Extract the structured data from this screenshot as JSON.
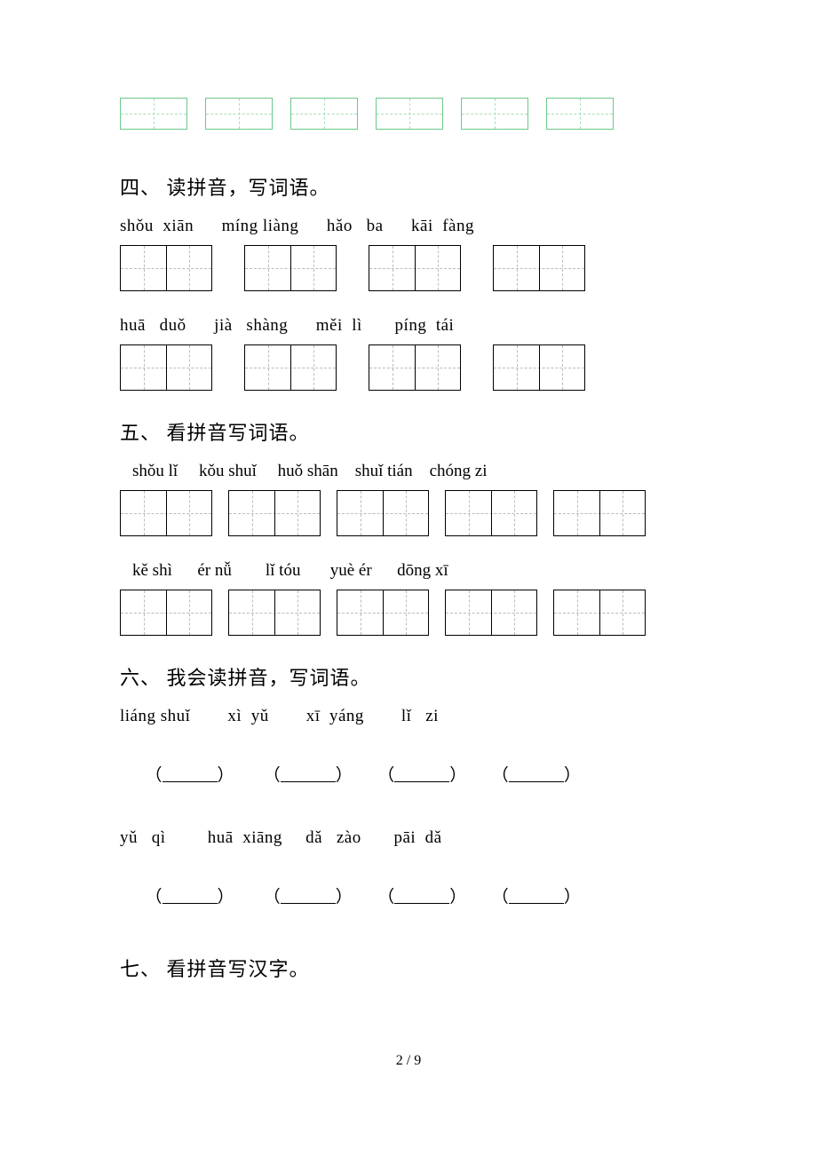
{
  "section4": {
    "heading": "四、 读拼音，写词语。",
    "row1_pinyin": "shǒu  xiān      míng liàng      hǎo   ba      kāi  fàng",
    "row2_pinyin": "huā   duǒ      jià   shàng      měi  lì       píng  tái"
  },
  "section5": {
    "heading": "五、 看拼音写词语。",
    "row1_pinyin": "shǒu lǐ     kǒu shuǐ     huǒ shān    shuǐ tián    chóng zi",
    "row2_pinyin": "kě shì      ér nǚ        lǐ tóu       yuè ér      dōng xī"
  },
  "section6": {
    "heading": "六、 我会读拼音，写词语。",
    "row1_pinyin": "liáng shuǐ        xì  yǔ        xī  yáng        lǐ   zi",
    "row2_pinyin": "yǔ   qì         huā  xiāng     dǎ   zào       pāi  dǎ"
  },
  "section7": {
    "heading": "七、 看拼音写汉字。"
  },
  "footer": "2 / 9"
}
